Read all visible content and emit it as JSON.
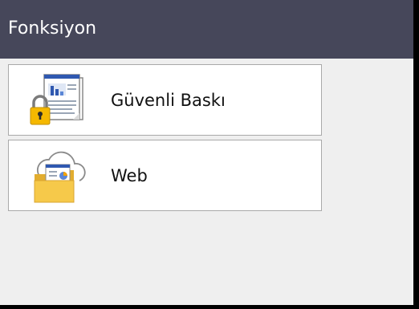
{
  "header": {
    "title": "Fonksiyon"
  },
  "menu": {
    "items": [
      {
        "label": "Güvenli Baskı",
        "icon": "secure-print-icon"
      },
      {
        "label": "Web",
        "icon": "web-cloud-folder-icon"
      }
    ]
  },
  "colors": {
    "titlebar": "#46475a",
    "background": "#efefef",
    "lock": "#f5b800",
    "folder": "#f6c94a",
    "chart_blue": "#3a62b8"
  }
}
